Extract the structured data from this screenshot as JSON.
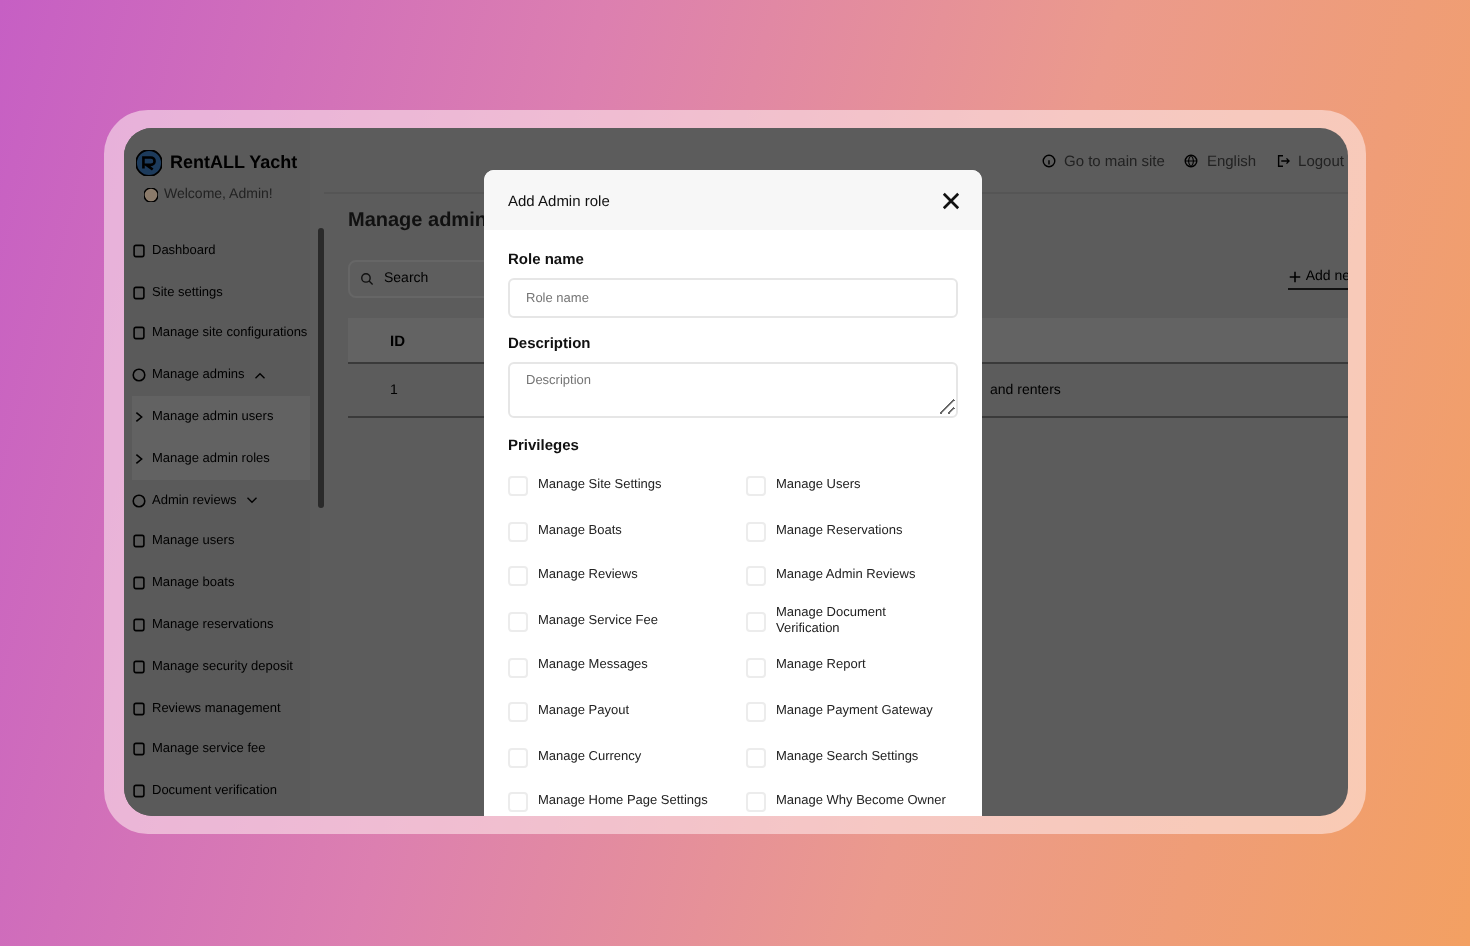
{
  "app": {
    "brand": "RentALL Yacht",
    "welcome": "Welcome, Admin!",
    "top_links": [
      {
        "label": "Go to main site",
        "kind": "info"
      },
      {
        "label": "English",
        "kind": "globe"
      },
      {
        "label": "Logout",
        "kind": "logout"
      }
    ],
    "sidebar": {
      "items": [
        {
          "label": "Dashboard",
          "kind": "link"
        },
        {
          "label": "Site settings",
          "kind": "link"
        },
        {
          "label": "Manage site configurations",
          "kind": "link"
        },
        {
          "label": "Manage admins",
          "kind": "group",
          "expanded": true,
          "children": [
            {
              "label": "Manage admin users"
            },
            {
              "label": "Manage admin roles"
            }
          ]
        },
        {
          "label": "Admin reviews",
          "kind": "group",
          "expanded": false
        },
        {
          "label": "Manage users",
          "kind": "link"
        },
        {
          "label": "Manage boats",
          "kind": "link"
        },
        {
          "label": "Manage reservations",
          "kind": "link"
        },
        {
          "label": "Manage security deposit",
          "kind": "link"
        },
        {
          "label": "Reviews management",
          "kind": "link"
        },
        {
          "label": "Manage service fee",
          "kind": "link"
        },
        {
          "label": "Document verification",
          "kind": "link"
        }
      ]
    }
  },
  "page": {
    "title": "Manage admin",
    "search": {
      "placeholder": "Search"
    },
    "add_button": "Add ne",
    "table": {
      "columns": [
        "ID"
      ],
      "rows": [
        {
          "id": "1",
          "column_3": "and renters"
        }
      ]
    }
  },
  "modal": {
    "title": "Add Admin role",
    "role_name": {
      "label": "Role name",
      "placeholder": "Role name"
    },
    "description": {
      "label": "Description",
      "placeholder": "Description"
    },
    "privileges_label": "Privileges",
    "privileges": [
      {
        "label": "Manage Site Settings",
        "checked": false
      },
      {
        "label": "Manage Users",
        "checked": false
      },
      {
        "label": "Manage Boats",
        "checked": false
      },
      {
        "label": "Manage Reservations",
        "checked": false
      },
      {
        "label": "Manage Reviews",
        "checked": false
      },
      {
        "label": "Manage Admin Reviews",
        "checked": false
      },
      {
        "label": "Manage Service Fee",
        "checked": false
      },
      {
        "label": "Manage Document Verification",
        "checked": false
      },
      {
        "label": "Manage Messages",
        "checked": false
      },
      {
        "label": "Manage Report",
        "checked": false
      },
      {
        "label": "Manage Payout",
        "checked": false
      },
      {
        "label": "Manage Payment Gateway",
        "checked": false
      },
      {
        "label": "Manage Currency",
        "checked": false
      },
      {
        "label": "Manage Search Settings",
        "checked": false
      },
      {
        "label": "Manage Home Page Settings",
        "checked": false
      },
      {
        "label": "Manage Why Become Owner",
        "checked": false
      }
    ]
  }
}
